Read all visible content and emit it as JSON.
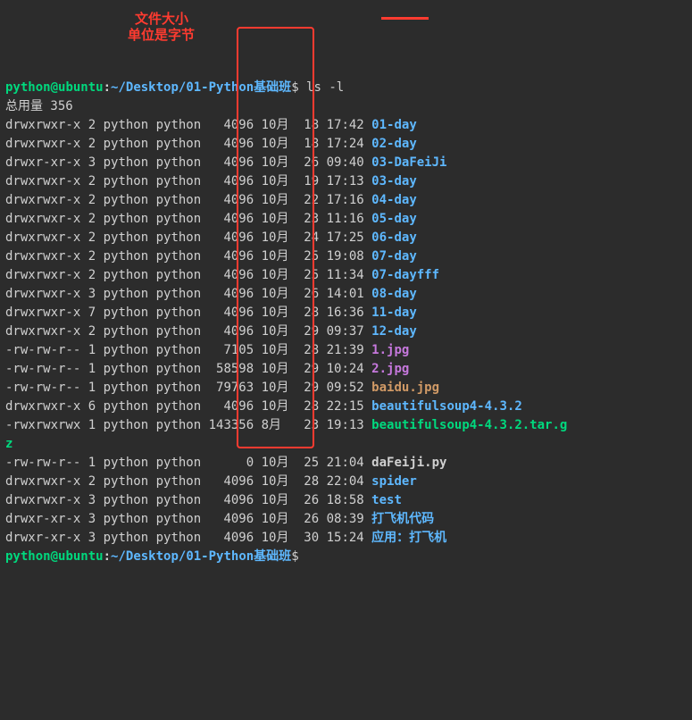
{
  "prompt": {
    "user": "python",
    "at": "@",
    "host": "ubuntu",
    "colon": ":",
    "path": "~/Desktop/01-Python基础班",
    "dollar": "$ ",
    "cmd": "ls -l"
  },
  "total_label": "总用量 356",
  "annotations": {
    "line1": "文件大小",
    "line2": "单位是字节"
  },
  "rows": [
    {
      "perm": "drwxrwxr-x",
      "n": "2",
      "u": "python",
      "g": "python",
      "size": "4096",
      "mon": "10月",
      "day": "18",
      "time": "17:42",
      "name": "01-day",
      "cls": "dir"
    },
    {
      "perm": "drwxrwxr-x",
      "n": "2",
      "u": "python",
      "g": "python",
      "size": "4096",
      "mon": "10月",
      "day": "18",
      "time": "17:24",
      "name": "02-day",
      "cls": "dir"
    },
    {
      "perm": "drwxr-xr-x",
      "n": "3",
      "u": "python",
      "g": "python",
      "size": "4096",
      "mon": "10月",
      "day": "26",
      "time": "09:40",
      "name": "03-DaFeiJi",
      "cls": "dir"
    },
    {
      "perm": "drwxrwxr-x",
      "n": "2",
      "u": "python",
      "g": "python",
      "size": "4096",
      "mon": "10月",
      "day": "19",
      "time": "17:13",
      "name": "03-day",
      "cls": "dir"
    },
    {
      "perm": "drwxrwxr-x",
      "n": "2",
      "u": "python",
      "g": "python",
      "size": "4096",
      "mon": "10月",
      "day": "22",
      "time": "17:16",
      "name": "04-day",
      "cls": "dir"
    },
    {
      "perm": "drwxrwxr-x",
      "n": "2",
      "u": "python",
      "g": "python",
      "size": "4096",
      "mon": "10月",
      "day": "23",
      "time": "11:16",
      "name": "05-day",
      "cls": "dir"
    },
    {
      "perm": "drwxrwxr-x",
      "n": "2",
      "u": "python",
      "g": "python",
      "size": "4096",
      "mon": "10月",
      "day": "24",
      "time": "17:25",
      "name": "06-day",
      "cls": "dir"
    },
    {
      "perm": "drwxrwxr-x",
      "n": "2",
      "u": "python",
      "g": "python",
      "size": "4096",
      "mon": "10月",
      "day": "25",
      "time": "19:08",
      "name": "07-day",
      "cls": "dir"
    },
    {
      "perm": "drwxrwxr-x",
      "n": "2",
      "u": "python",
      "g": "python",
      "size": "4096",
      "mon": "10月",
      "day": "25",
      "time": "11:34",
      "name": "07-dayfff",
      "cls": "dir"
    },
    {
      "perm": "drwxrwxr-x",
      "n": "3",
      "u": "python",
      "g": "python",
      "size": "4096",
      "mon": "10月",
      "day": "26",
      "time": "14:01",
      "name": "08-day",
      "cls": "dir"
    },
    {
      "perm": "drwxrwxr-x",
      "n": "7",
      "u": "python",
      "g": "python",
      "size": "4096",
      "mon": "10月",
      "day": "28",
      "time": "16:36",
      "name": "11-day",
      "cls": "dir"
    },
    {
      "perm": "drwxrwxr-x",
      "n": "2",
      "u": "python",
      "g": "python",
      "size": "4096",
      "mon": "10月",
      "day": "29",
      "time": "09:37",
      "name": "12-day",
      "cls": "dir"
    },
    {
      "perm": "-rw-rw-r--",
      "n": "1",
      "u": "python",
      "g": "python",
      "size": "7105",
      "mon": "10月",
      "day": "28",
      "time": "21:39",
      "name": "1.jpg",
      "cls": "file"
    },
    {
      "perm": "-rw-rw-r--",
      "n": "1",
      "u": "python",
      "g": "python",
      "size": "58598",
      "mon": "10月",
      "day": "29",
      "time": "10:24",
      "name": "2.jpg",
      "cls": "file"
    },
    {
      "perm": "-rw-rw-r--",
      "n": "1",
      "u": "python",
      "g": "python",
      "size": "79763",
      "mon": "10月",
      "day": "29",
      "time": "09:52",
      "name": "baidu.jpg",
      "cls": "img"
    },
    {
      "perm": "drwxrwxr-x",
      "n": "6",
      "u": "python",
      "g": "python",
      "size": "4096",
      "mon": "10月",
      "day": "28",
      "time": "22:15",
      "name": "beautifulsoup4-4.3.2",
      "cls": "dir"
    },
    {
      "perm": "-rwxrwxrwx",
      "n": "1",
      "u": "python",
      "g": "python",
      "size": "143356",
      "mon": "8月 ",
      "day": "23",
      "time": "19:13",
      "name": "beautifulsoup4-4.3.2.tar.g",
      "cls": "exec"
    }
  ],
  "wrap": "z",
  "rows2": [
    {
      "perm": "-rw-rw-r--",
      "n": "1",
      "u": "python",
      "g": "python",
      "size": "0",
      "mon": "10月",
      "day": "25",
      "time": "21:04",
      "name": "daFeiji.py",
      "cls": "white"
    },
    {
      "perm": "drwxrwxr-x",
      "n": "2",
      "u": "python",
      "g": "python",
      "size": "4096",
      "mon": "10月",
      "day": "28",
      "time": "22:04",
      "name": "spider",
      "cls": "dir"
    },
    {
      "perm": "drwxrwxr-x",
      "n": "3",
      "u": "python",
      "g": "python",
      "size": "4096",
      "mon": "10月",
      "day": "26",
      "time": "18:58",
      "name": "test",
      "cls": "dir"
    },
    {
      "perm": "drwxr-xr-x",
      "n": "3",
      "u": "python",
      "g": "python",
      "size": "4096",
      "mon": "10月",
      "day": "26",
      "time": "08:39",
      "name": "打飞机代码",
      "cls": "dir"
    },
    {
      "perm": "drwxr-xr-x",
      "n": "3",
      "u": "python",
      "g": "python",
      "size": "4096",
      "mon": "10月",
      "day": "30",
      "time": "15:24",
      "name": "应用：打飞机",
      "cls": "dir"
    }
  ],
  "prompt2": {
    "user": "python",
    "at": "@",
    "host": "ubuntu",
    "colon": ":",
    "path": "~/Desktop/01-Python基础班",
    "dollar": "$ "
  }
}
